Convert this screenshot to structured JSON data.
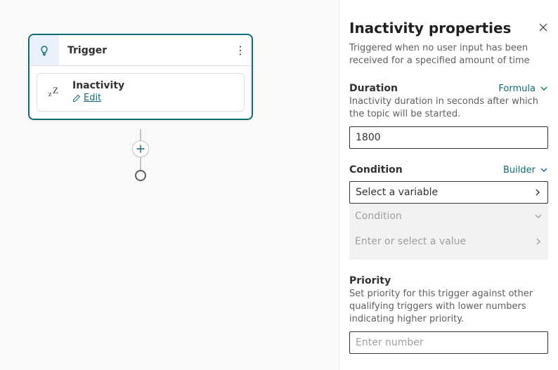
{
  "canvas": {
    "trigger_header": "Trigger",
    "item_title": "Inactivity",
    "edit_label": "Edit"
  },
  "panel": {
    "title": "Inactivity properties",
    "description": "Triggered when no user input has been received for a specified amount of time",
    "duration": {
      "label": "Duration",
      "mode": "Formula",
      "help": "Inactivity duration in seconds after which the topic will be started.",
      "value": "1800"
    },
    "condition": {
      "label": "Condition",
      "mode": "Builder",
      "variable_placeholder": "Select a variable",
      "op_placeholder": "Condition",
      "value_placeholder": "Enter or select a value"
    },
    "priority": {
      "label": "Priority",
      "help": "Set priority for this trigger against other qualifying triggers with lower numbers indicating higher priority.",
      "placeholder": "Enter number"
    }
  }
}
